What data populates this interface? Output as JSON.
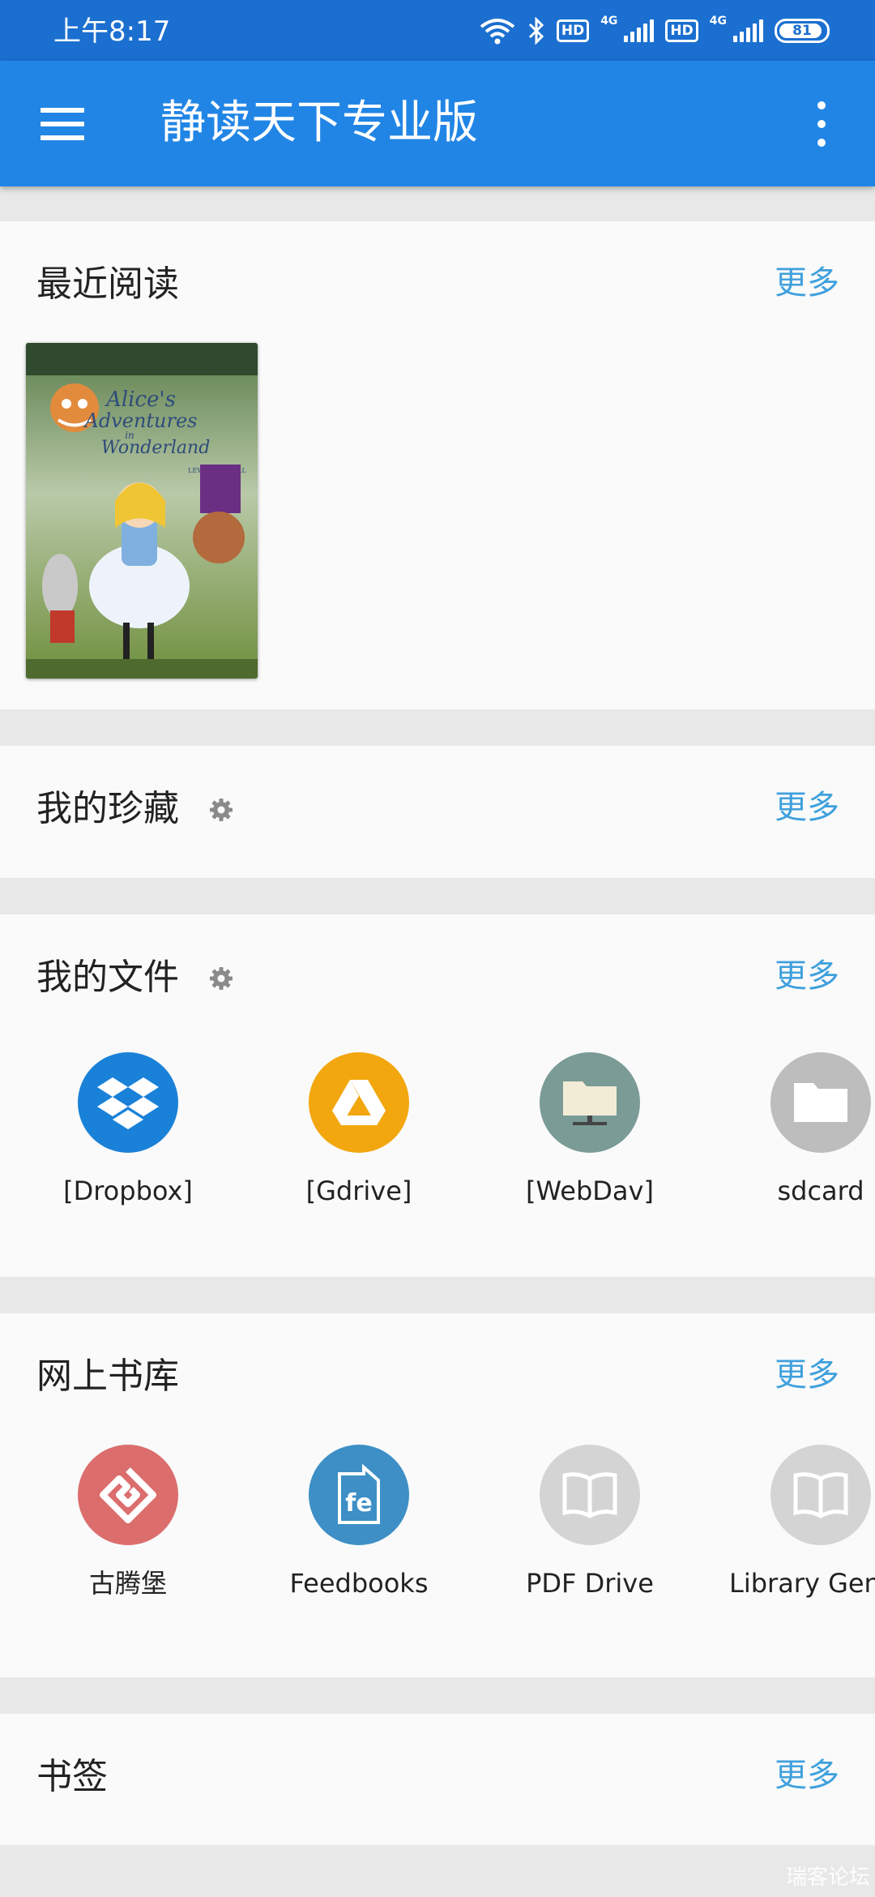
{
  "status_bar": {
    "time": "上午8:17",
    "hd1": "HD",
    "hd2": "HD",
    "net1": "4G",
    "net2": "4G",
    "battery": "81"
  },
  "app_bar": {
    "title": "静读天下专业版"
  },
  "recent": {
    "title": "最近阅读",
    "more": "更多",
    "book": {
      "title_line1": "Alice's",
      "title_line2": "Adventures",
      "title_line3": "in",
      "title_line4": "Wonderland",
      "author": "LEWIS CARROLL"
    }
  },
  "favorites": {
    "title": "我的珍藏",
    "more": "更多"
  },
  "files": {
    "title": "我的文件",
    "more": "更多",
    "items": [
      {
        "label": "[Dropbox]",
        "icon": "dropbox-icon",
        "color": "#1a81d8"
      },
      {
        "label": "[Gdrive]",
        "icon": "google-drive-icon",
        "color": "#f2a70f"
      },
      {
        "label": "[WebDav]",
        "icon": "network-folder-icon",
        "color": "#7a9b96"
      },
      {
        "label": "sdcard",
        "icon": "folder-icon",
        "color": "#bdbdbd"
      }
    ]
  },
  "online_library": {
    "title": "网上书库",
    "more": "更多",
    "items": [
      {
        "label": "古腾堡",
        "icon": "gutenberg-icon",
        "color": "#dc6d6d"
      },
      {
        "label": "Feedbooks",
        "icon": "feedbooks-icon",
        "color": "#3d8fc6"
      },
      {
        "label": "PDF Drive",
        "icon": "book-icon",
        "color": "#d4d4d4"
      },
      {
        "label": "Library Gene",
        "icon": "book-icon",
        "color": "#d4d4d4"
      }
    ]
  },
  "bookmarks": {
    "title": "书签",
    "more": "更多"
  },
  "watermark": "瑞客论坛"
}
